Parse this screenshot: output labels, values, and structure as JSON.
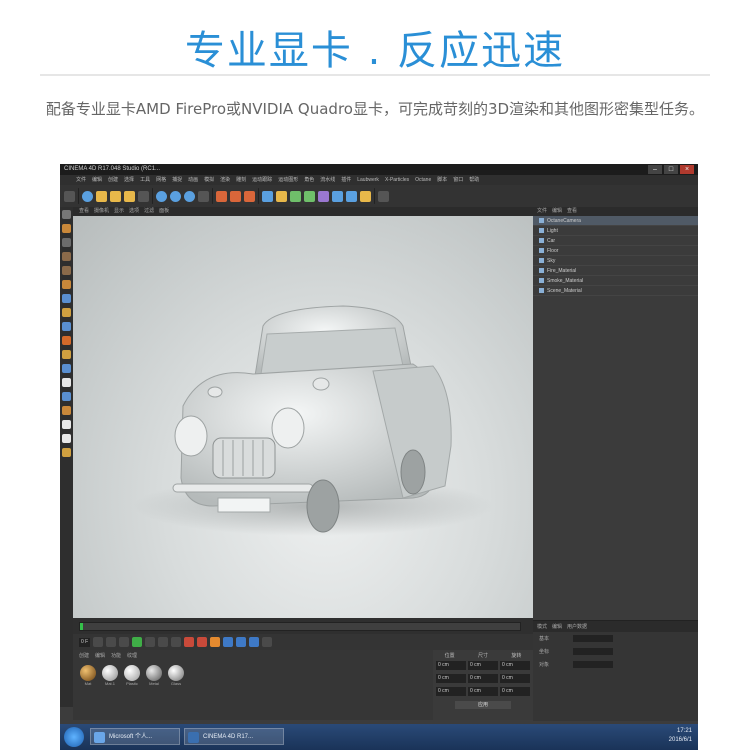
{
  "banner": {
    "title": "专业显卡 . 反应迅速",
    "subtitle": "配备专业显卡AMD FirePro或NVIDIA Quadro显卡，可完成苛刻的3D渲染和其他图形密集型任务。"
  },
  "app": {
    "title": "CINEMA 4D R17.048 Studio (RC1...",
    "menus": [
      "文件",
      "编辑",
      "创建",
      "选择",
      "工具",
      "网格",
      "捕捉",
      "动画",
      "模拟",
      "渲染",
      "雕刻",
      "运动跟踪",
      "运动图形",
      "角色",
      "流水线",
      "插件",
      "Laubwerk",
      "X-Particles",
      "Octane",
      "脚本",
      "窗口",
      "帮助"
    ],
    "viewport_menus": [
      "查看",
      "摄像机",
      "显示",
      "选项",
      "过滤",
      "面板"
    ],
    "objects": [
      "OctaneCamera",
      "Light",
      "Car",
      "Floor",
      "Sky",
      "Fire_Material",
      "Smoke_Material",
      "Scene_Material"
    ],
    "materials_menu": [
      "创建",
      "编辑",
      "功能",
      "纹理"
    ],
    "materials": [
      "Mat",
      "Mat.1",
      "Plastic",
      "Metal",
      "Glass"
    ],
    "coords_headers": [
      "位置",
      "尺寸",
      "旋转"
    ],
    "coord_values": [
      "0 cm",
      "0 cm",
      "0 cm"
    ],
    "apply_label": "应用",
    "attr_menu": [
      "模式",
      "编辑",
      "用户数据"
    ],
    "attr_keys": [
      "基本",
      "坐标",
      "对象"
    ],
    "frame_field": "0 F"
  },
  "taskbar": {
    "items": [
      "Microsoft 个人...",
      "CINEMA 4D R17..."
    ],
    "time": "17:21",
    "date": "2016/6/1"
  },
  "colors": {
    "accent": "#2a8fd6",
    "app_bg": "#3c3c3c",
    "viewport_bg": "#d8dcdc"
  }
}
